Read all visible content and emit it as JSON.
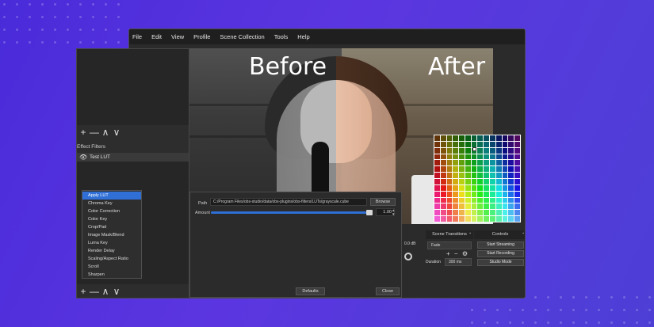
{
  "menu": [
    "File",
    "Edit",
    "View",
    "Profile",
    "Scene Collection",
    "Tools",
    "Help"
  ],
  "preview": {
    "before_label": "Before",
    "after_label": "After"
  },
  "filters_panel": {
    "title": "Effect Filters",
    "items": [
      {
        "label": "Test LUT"
      }
    ],
    "toolbar": [
      "+",
      "—",
      "∧",
      "∨"
    ]
  },
  "context_menu": {
    "items": [
      "Apply LUT",
      "Chroma Key",
      "Color Correction",
      "Color Key",
      "Crop/Pad",
      "Image Mask/Blend",
      "Luma Key",
      "Render Delay",
      "Scaling/Aspect Ratio",
      "Scroll",
      "Sharpen"
    ],
    "selected_index": 0
  },
  "filter_properties": {
    "path_label": "Path",
    "path_value": "C:/Program Files/obs-studio/data/obs-plugins/obs-filters/LUTs/grayscale.cube",
    "browse_label": "Browse",
    "amount_label": "Amount",
    "amount_value": "1.00",
    "amount_fraction": 0.97,
    "defaults_label": "Defaults",
    "close_label": "Close"
  },
  "audio_strip": {
    "db_value": "0.0 dB"
  },
  "scene_transitions": {
    "title": "Scene Transitions",
    "selected": "Fade",
    "duration_label": "Duration",
    "duration_value": "300 ms"
  },
  "controls": {
    "title": "Controls",
    "buttons": [
      "Start Streaming",
      "Start Recording",
      "Studio Mode"
    ]
  },
  "colors": {
    "accent": "#2f6fd6",
    "background": "#4f35d8"
  }
}
